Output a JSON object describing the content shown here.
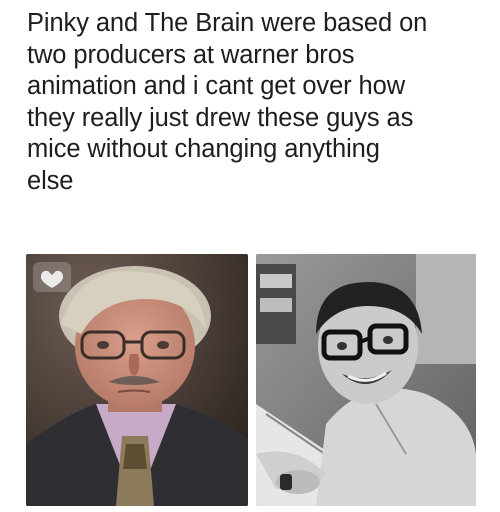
{
  "caption": {
    "lines": [
      "Pinky and The Brain were based on",
      "two producers at warner bros",
      "animation and i cant get over how",
      "they really just drew these guys as",
      "mice without changing anything",
      "else"
    ]
  },
  "images": {
    "left": {
      "icon": "heart-hands-icon"
    },
    "right": {}
  }
}
